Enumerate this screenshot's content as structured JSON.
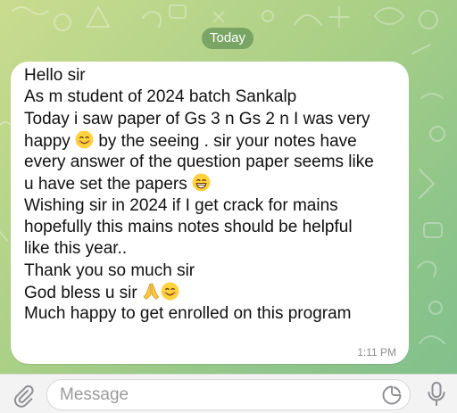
{
  "chat": {
    "date_label": "Today",
    "message": {
      "lines": [
        "Hello sir",
        "As m student of 2024 batch Sankalp",
        "Today i saw paper of Gs 3 n Gs 2  n I was very",
        "happy",
        " by the seeing . sir your notes have",
        "every answer of the question paper seems like",
        "u have set the papers",
        "Wishing sir in 2024 if I get crack for mains",
        "hopefully this mains notes should be helpful",
        "like this year..",
        "Thank you so much sir",
        "God bless u sir",
        "Much happy to get enrolled on this program"
      ],
      "time": "1:11 PM"
    }
  },
  "composer": {
    "placeholder": "Message",
    "icons": [
      "paperclip-icon",
      "sticker-icon",
      "microphone-icon"
    ]
  },
  "colors": {
    "wallpaper_green": "#a9cf86",
    "bubble": "#ffffff",
    "date_pill": "#5a8c50",
    "emoji_yellow": "#ffd23e"
  }
}
